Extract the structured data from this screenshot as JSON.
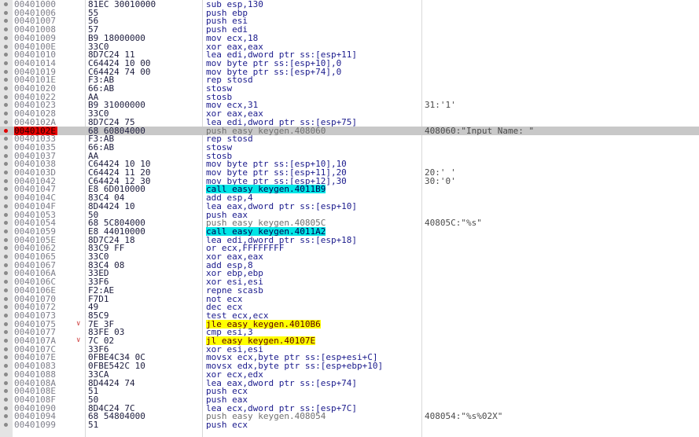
{
  "disassembly": {
    "rows": [
      {
        "addr": "00401000",
        "bytes": "81EC 30010000",
        "ins": "sub esp,130",
        "comment": "",
        "kind": ""
      },
      {
        "addr": "00401006",
        "bytes": "55",
        "ins": "push ebp",
        "comment": "",
        "kind": ""
      },
      {
        "addr": "00401007",
        "bytes": "56",
        "ins": "push esi",
        "comment": "",
        "kind": ""
      },
      {
        "addr": "00401008",
        "bytes": "57",
        "ins": "push edi",
        "comment": "",
        "kind": ""
      },
      {
        "addr": "00401009",
        "bytes": "B9 18000000",
        "ins": "mov ecx,18",
        "comment": "",
        "kind": ""
      },
      {
        "addr": "0040100E",
        "bytes": "33C0",
        "ins": "xor eax,eax",
        "comment": "",
        "kind": ""
      },
      {
        "addr": "00401010",
        "bytes": "8D7C24 11",
        "ins": "lea edi,dword ptr ss:[esp+11]",
        "comment": "",
        "kind": ""
      },
      {
        "addr": "00401014",
        "bytes": "C64424 10 00",
        "ins": "mov byte ptr ss:[esp+10],0",
        "comment": "",
        "kind": ""
      },
      {
        "addr": "00401019",
        "bytes": "C64424 74 00",
        "ins": "mov byte ptr ss:[esp+74],0",
        "comment": "",
        "kind": ""
      },
      {
        "addr": "0040101E",
        "bytes": "F3:AB",
        "ins": "rep stosd",
        "comment": "",
        "kind": ""
      },
      {
        "addr": "00401020",
        "bytes": "66:AB",
        "ins": "stosw",
        "comment": "",
        "kind": ""
      },
      {
        "addr": "00401022",
        "bytes": "AA",
        "ins": "stosb",
        "comment": "",
        "kind": ""
      },
      {
        "addr": "00401023",
        "bytes": "B9 31000000",
        "ins": "mov ecx,31",
        "comment": "31:'1'",
        "kind": ""
      },
      {
        "addr": "00401028",
        "bytes": "33C0",
        "ins": "xor eax,eax",
        "comment": "",
        "kind": ""
      },
      {
        "addr": "0040102A",
        "bytes": "8D7C24 75",
        "ins": "lea edi,dword ptr ss:[esp+75]",
        "comment": "",
        "kind": ""
      },
      {
        "addr": "0040102E",
        "bytes": "68 60804000",
        "ins": "push easy keygen.408060",
        "comment": "408060:\"Input Name: \"",
        "kind": "current"
      },
      {
        "addr": "00401033",
        "bytes": "F3:AB",
        "ins": "rep stosd",
        "comment": "",
        "kind": ""
      },
      {
        "addr": "00401035",
        "bytes": "66:AB",
        "ins": "stosw",
        "comment": "",
        "kind": ""
      },
      {
        "addr": "00401037",
        "bytes": "AA",
        "ins": "stosb",
        "comment": "",
        "kind": ""
      },
      {
        "addr": "00401038",
        "bytes": "C64424 10 10",
        "ins": "mov byte ptr ss:[esp+10],10",
        "comment": "",
        "kind": ""
      },
      {
        "addr": "0040103D",
        "bytes": "C64424 11 20",
        "ins": "mov byte ptr ss:[esp+11],20",
        "comment": "20:' '",
        "kind": ""
      },
      {
        "addr": "00401042",
        "bytes": "C64424 12 30",
        "ins": "mov byte ptr ss:[esp+12],30",
        "comment": "30:'0'",
        "kind": ""
      },
      {
        "addr": "00401047",
        "bytes": "E8 6D010000",
        "ins": "call easy keygen.4011B9",
        "comment": "",
        "kind": "call"
      },
      {
        "addr": "0040104C",
        "bytes": "83C4 04",
        "ins": "add esp,4",
        "comment": "",
        "kind": ""
      },
      {
        "addr": "0040104F",
        "bytes": "8D4424 10",
        "ins": "lea eax,dword ptr ss:[esp+10]",
        "comment": "",
        "kind": ""
      },
      {
        "addr": "00401053",
        "bytes": "50",
        "ins": "push eax",
        "comment": "",
        "kind": ""
      },
      {
        "addr": "00401054",
        "bytes": "68 5C804000",
        "ins": "push easy keygen.40805C",
        "comment": "40805C:\"%s\"",
        "kind": "gray"
      },
      {
        "addr": "00401059",
        "bytes": "E8 44010000",
        "ins": "call easy keygen.4011A2",
        "comment": "",
        "kind": "call"
      },
      {
        "addr": "0040105E",
        "bytes": "8D7C24 18",
        "ins": "lea edi,dword ptr ss:[esp+18]",
        "comment": "",
        "kind": ""
      },
      {
        "addr": "00401062",
        "bytes": "83C9 FF",
        "ins": "or ecx,FFFFFFFF",
        "comment": "",
        "kind": ""
      },
      {
        "addr": "00401065",
        "bytes": "33C0",
        "ins": "xor eax,eax",
        "comment": "",
        "kind": ""
      },
      {
        "addr": "00401067",
        "bytes": "83C4 08",
        "ins": "add esp,8",
        "comment": "",
        "kind": ""
      },
      {
        "addr": "0040106A",
        "bytes": "33ED",
        "ins": "xor ebp,ebp",
        "comment": "",
        "kind": ""
      },
      {
        "addr": "0040106C",
        "bytes": "33F6",
        "ins": "xor esi,esi",
        "comment": "",
        "kind": ""
      },
      {
        "addr": "0040106E",
        "bytes": "F2:AE",
        "ins": "repne scasb",
        "comment": "",
        "kind": ""
      },
      {
        "addr": "00401070",
        "bytes": "F7D1",
        "ins": "not ecx",
        "comment": "",
        "kind": ""
      },
      {
        "addr": "00401072",
        "bytes": "49",
        "ins": "dec ecx",
        "comment": "",
        "kind": ""
      },
      {
        "addr": "00401073",
        "bytes": "85C9",
        "ins": "test ecx,ecx",
        "comment": "",
        "kind": ""
      },
      {
        "addr": "00401075",
        "bytes": "7E 3F",
        "ins": "jle easy keygen.4010B6",
        "comment": "",
        "kind": "jmp",
        "arrow": "v"
      },
      {
        "addr": "00401077",
        "bytes": "83FE 03",
        "ins": "cmp esi,3",
        "comment": "",
        "kind": ""
      },
      {
        "addr": "0040107A",
        "bytes": "7C 02",
        "ins": "jl easy keygen.40107E",
        "comment": "",
        "kind": "jmp",
        "arrow": "v"
      },
      {
        "addr": "0040107C",
        "bytes": "33F6",
        "ins": "xor esi,esi",
        "comment": "",
        "kind": ""
      },
      {
        "addr": "0040107E",
        "bytes": "0FBE4C34 0C",
        "ins": "movsx ecx,byte ptr ss:[esp+esi+C]",
        "comment": "",
        "kind": ""
      },
      {
        "addr": "00401083",
        "bytes": "0FBE542C 10",
        "ins": "movsx edx,byte ptr ss:[esp+ebp+10]",
        "comment": "",
        "kind": ""
      },
      {
        "addr": "00401088",
        "bytes": "33CA",
        "ins": "xor ecx,edx",
        "comment": "",
        "kind": ""
      },
      {
        "addr": "0040108A",
        "bytes": "8D4424 74",
        "ins": "lea eax,dword ptr ss:[esp+74]",
        "comment": "",
        "kind": ""
      },
      {
        "addr": "0040108E",
        "bytes": "51",
        "ins": "push ecx",
        "comment": "",
        "kind": ""
      },
      {
        "addr": "0040108F",
        "bytes": "50",
        "ins": "push eax",
        "comment": "",
        "kind": ""
      },
      {
        "addr": "00401090",
        "bytes": "8D4C24 7C",
        "ins": "lea ecx,dword ptr ss:[esp+7C]",
        "comment": "",
        "kind": ""
      },
      {
        "addr": "00401094",
        "bytes": "68 54804000",
        "ins": "push easy keygen.408054",
        "comment": "408054:\"%s%02X\"",
        "kind": "gray"
      },
      {
        "addr": "00401099",
        "bytes": "51",
        "ins": "push ecx",
        "comment": "",
        "kind": ""
      }
    ]
  }
}
